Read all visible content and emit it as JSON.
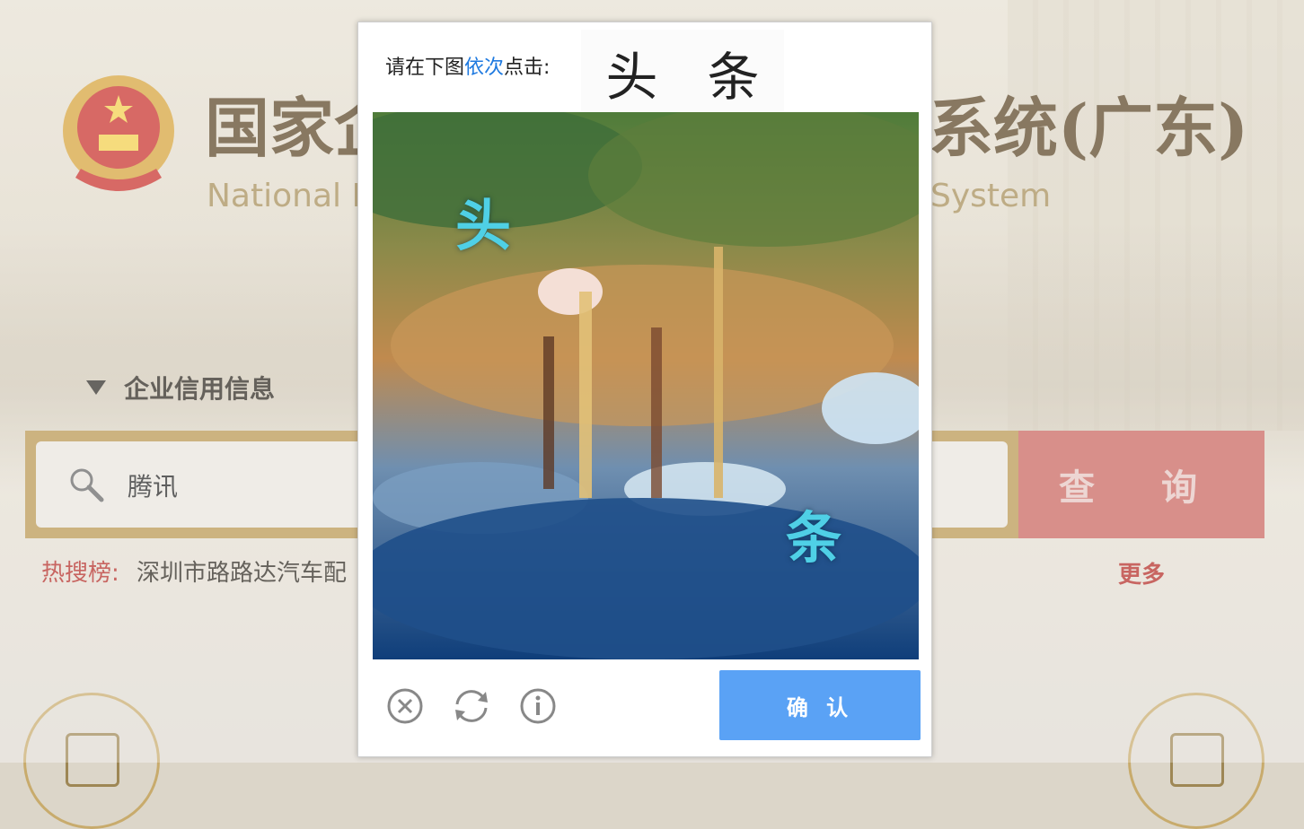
{
  "background_page": {
    "title_left": "国家企",
    "title_right": "系统(广东)",
    "subtitle_left": "National E",
    "subtitle_right": "System",
    "category_label": "企业信用信息",
    "search_value": "腾讯",
    "search_button_label": "查 询",
    "hot_search_label": "热搜榜:",
    "hot_search_item": "深圳市路路达汽车配",
    "more_label": "更多"
  },
  "captcha": {
    "prompt_prefix": "请在下图",
    "prompt_emphasis": "依次",
    "prompt_suffix": "点击:",
    "target_chars": [
      "头",
      "条"
    ],
    "image_chars": [
      "头",
      "条"
    ],
    "confirm_label": "确 认",
    "icons": [
      "close-icon",
      "refresh-icon",
      "info-icon"
    ],
    "colors": {
      "confirm": "#5aa2f5",
      "emphasis": "#1f7ae0"
    }
  }
}
